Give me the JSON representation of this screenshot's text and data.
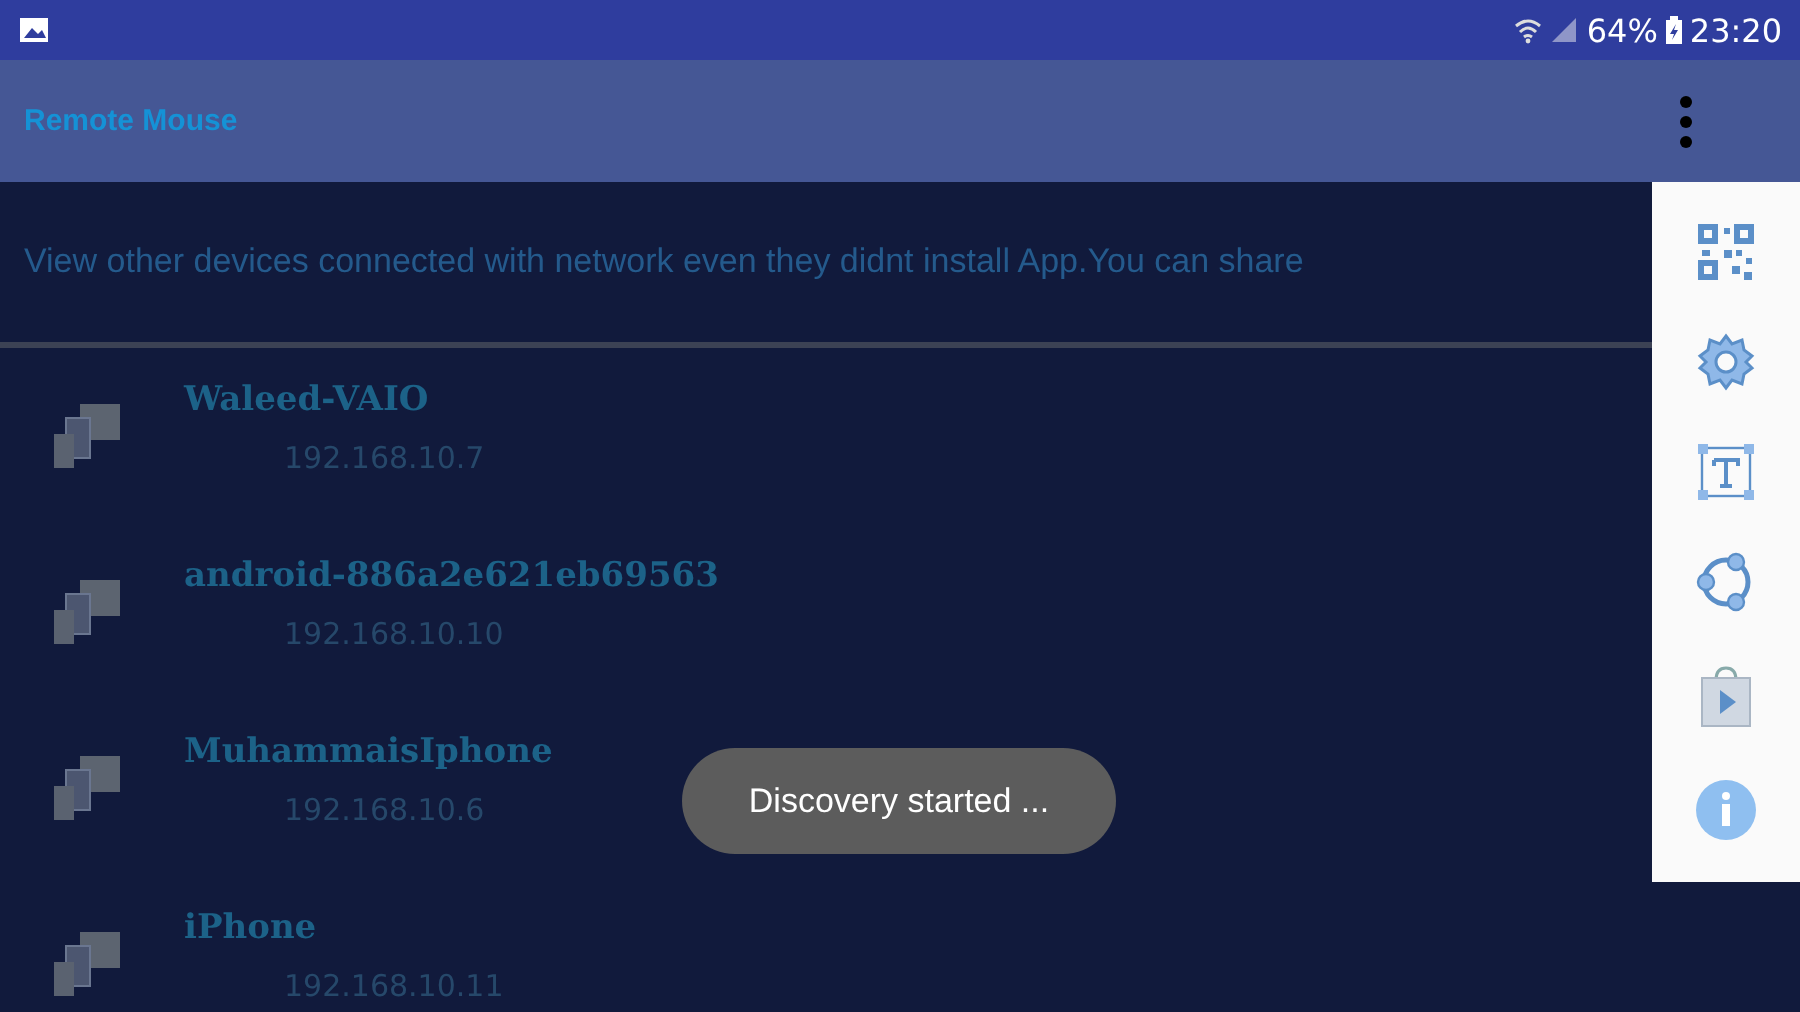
{
  "status_bar": {
    "battery": "64%",
    "time": "23:20"
  },
  "app_bar": {
    "title": "Remote Mouse"
  },
  "description": "View other devices connected with network even they didnt install App.You can share",
  "devices": [
    {
      "name": "Waleed-VAIO",
      "ip": "192.168.10.7"
    },
    {
      "name": "android-886a2e621eb69563",
      "ip": "192.168.10.10"
    },
    {
      "name": "MuhammaisIphone",
      "ip": "192.168.10.6"
    },
    {
      "name": "iPhone",
      "ip": "192.168.10.11"
    }
  ],
  "toast": "Discovery started ..."
}
